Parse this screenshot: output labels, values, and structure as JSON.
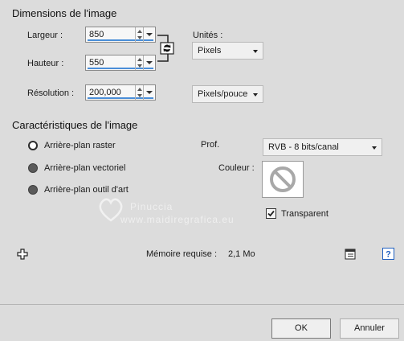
{
  "image_dimensions": {
    "title": "Dimensions de l'image",
    "width_label": "Largeur :",
    "width_value": "850",
    "height_label": "Hauteur :",
    "height_value": "550",
    "resolution_label": "Résolution :",
    "resolution_value": "200,000",
    "units_label": "Unités :",
    "units_value": "Pixels",
    "resolution_units_value": "Pixels/pouce"
  },
  "image_characteristics": {
    "title": "Caractéristiques de l'image",
    "options": [
      {
        "label": "Arrière-plan raster",
        "selected": true
      },
      {
        "label": "Arrière-plan vectoriel",
        "selected": false
      },
      {
        "label": "Arrière-plan outil d'art",
        "selected": false
      }
    ],
    "depth_label": "Prof.",
    "depth_value": "RVB - 8 bits/canal",
    "color_label": "Couleur :",
    "transparent_label": "Transparent",
    "transparent_checked": true
  },
  "watermark": {
    "line1": "Pinuccia",
    "line2": "www.maidiregrafica.eu"
  },
  "footer": {
    "memory_label": "Mémoire requise :",
    "memory_value": "2,1 Mo",
    "ok_label": "OK",
    "cancel_label": "Annuler"
  },
  "icons": {
    "link": "link-aspect-icon",
    "no_color": "no-color-icon",
    "add": "plus-icon",
    "preset": "preset-icon",
    "help": "help-icon"
  },
  "colors": {
    "dialog_bg": "#dcdcdc",
    "accent_underline": "#4a8ed8",
    "help_blue": "#1f5fbf"
  }
}
